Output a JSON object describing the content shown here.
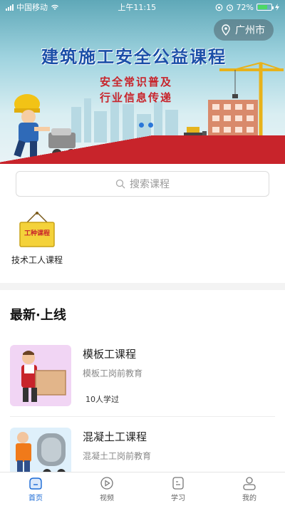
{
  "status_bar": {
    "carrier": "中国移动",
    "time": "上午11:15",
    "battery": "72%",
    "battery_level": 0.72
  },
  "banner": {
    "title": "建筑施工安全公益课程",
    "subtitle_line1": "安全常识普及",
    "subtitle_line2": "行业信息传递",
    "location": "广州市",
    "location_icon": "location-pin-icon",
    "sign_text": "工种课程"
  },
  "search": {
    "placeholder": "搜索课程",
    "icon": "search-icon"
  },
  "categories": [
    {
      "label": "技术工人课程",
      "icon": "sign-board-icon",
      "sign_text": "工种课程"
    }
  ],
  "section": {
    "title": "最新·上线"
  },
  "courses": [
    {
      "name": "模板工课程",
      "desc": "模板工岗前教育",
      "learned": "10人学过",
      "thumb_bg": "#f1d5f4"
    },
    {
      "name": "混凝土工课程",
      "desc": "混凝土工岗前教育",
      "thumb_bg": "#dff0fb"
    }
  ],
  "tabbar": {
    "items": [
      {
        "label": "首页",
        "icon": "home-icon",
        "active": true
      },
      {
        "label": "视频",
        "icon": "play-icon",
        "active": false
      },
      {
        "label": "学习",
        "icon": "study-icon",
        "active": false
      },
      {
        "label": "我的",
        "icon": "user-icon",
        "active": false
      }
    ]
  },
  "colors": {
    "accent": "#1a6ad6",
    "banner_title": "#1b4fa8",
    "banner_red": "#c8242b"
  }
}
